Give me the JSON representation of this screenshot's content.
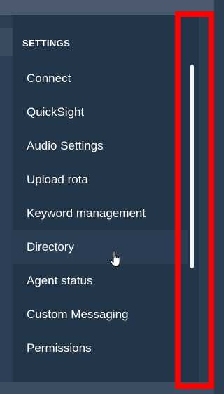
{
  "settings_menu": {
    "section_title": "SETTINGS",
    "items": [
      {
        "label": "Connect"
      },
      {
        "label": "QuickSight"
      },
      {
        "label": "Audio Settings"
      },
      {
        "label": "Upload rota"
      },
      {
        "label": "Keyword management"
      },
      {
        "label": "Directory"
      },
      {
        "label": "Agent status"
      },
      {
        "label": "Custom Messaging"
      },
      {
        "label": "Permissions"
      }
    ],
    "hovered_item": "Directory"
  },
  "icons": {
    "cursor": "hand-pointer-icon"
  },
  "colors": {
    "panel_background": "#233549",
    "page_background": "#2c3d52",
    "text": "#ffffff",
    "scroll_thumb": "#f2f4f7",
    "highlight": "#ff0000"
  }
}
